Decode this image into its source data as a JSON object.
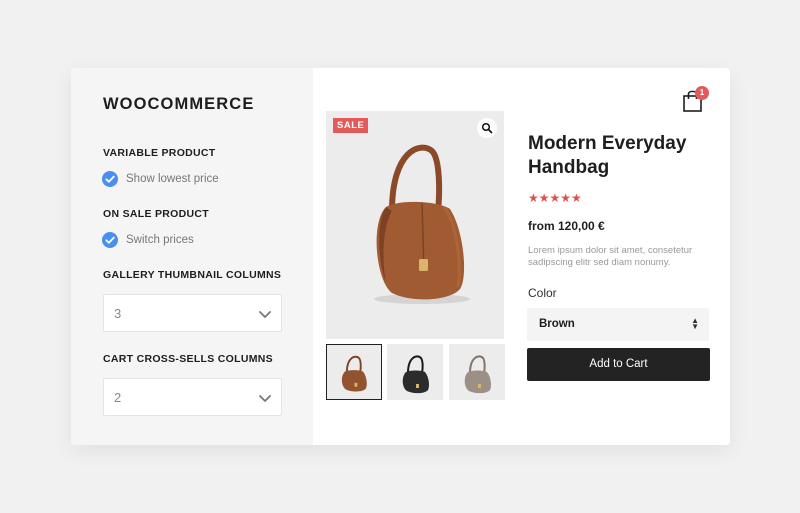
{
  "settings": {
    "brand": "WOOCOMMERCE",
    "variable_product": {
      "title": "VARIABLE PRODUCT",
      "option_label": "Show lowest price",
      "checked": true
    },
    "on_sale_product": {
      "title": "ON SALE PRODUCT",
      "option_label": "Switch prices",
      "checked": true
    },
    "gallery_columns": {
      "title": "GALLERY THUMBNAIL COLUMNS",
      "value": "3"
    },
    "cross_sells_columns": {
      "title": "CART CROSS-SELLS COLUMNS",
      "value": "2"
    }
  },
  "product": {
    "badge": "SALE",
    "name": "Modern Everyday Handbag",
    "rating": 5,
    "stars": "★★★★★",
    "price": "from 120,00 €",
    "description": "Lorem ipsum dolor sit amet, consetetur sadipscing elitr sed diam nonumy.",
    "color_label": "Color",
    "color_value": "Brown",
    "add_to_cart": "Add to Cart",
    "thumbnails": [
      {
        "color": "brown",
        "hex": "#93532f"
      },
      {
        "color": "black",
        "hex": "#2c2c2c"
      },
      {
        "color": "taupe",
        "hex": "#9b9085"
      }
    ]
  },
  "cart": {
    "count": "1"
  },
  "colors": {
    "accent_blue": "#4a8ff0",
    "sale_red": "#e25a5a",
    "button_dark": "#232323",
    "panel_bg": "#f5f5f5"
  }
}
